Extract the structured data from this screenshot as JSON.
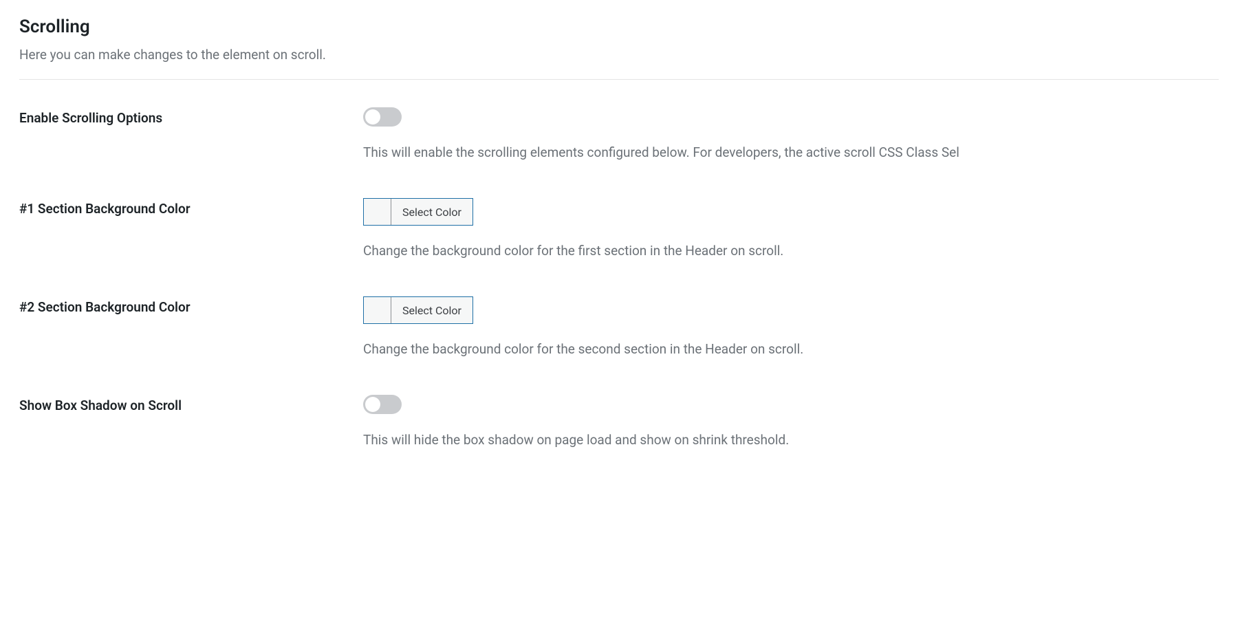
{
  "section": {
    "title": "Scrolling",
    "subtitle": "Here you can make changes to the element on scroll."
  },
  "settings": {
    "enable_scrolling": {
      "label": "Enable Scrolling Options",
      "description": "This will enable the scrolling elements configured below. For developers, the active scroll CSS Class Sel",
      "value": false
    },
    "section1_bg": {
      "label": "#1 Section Background Color",
      "button": "Select Color",
      "description": "Change the background color for the first section in the Header on scroll."
    },
    "section2_bg": {
      "label": "#2 Section Background Color",
      "button": "Select Color",
      "description": "Change the background color for the second section in the Header on scroll."
    },
    "box_shadow": {
      "label": "Show Box Shadow on Scroll",
      "description": "This will hide the box shadow on page load and show on shrink threshold.",
      "value": false
    }
  }
}
